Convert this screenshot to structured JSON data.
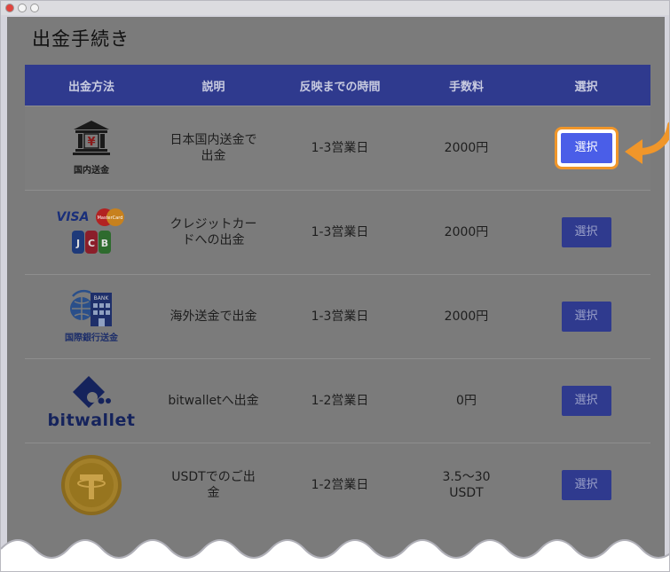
{
  "page": {
    "title": "出金手続き"
  },
  "table": {
    "headers": [
      "出金方法",
      "説明",
      "反映までの時間",
      "手数料",
      "選択"
    ],
    "rows": [
      {
        "method_label": "国内送金",
        "description": "日本国内送金で出金",
        "time": "1-3営業日",
        "fee": "2000円",
        "button": "選択",
        "icon": "bank-icon",
        "highlighted": true
      },
      {
        "method_label": "",
        "description": "クレジットカードへの出金",
        "time": "1-3営業日",
        "fee": "2000円",
        "button": "選択",
        "icon": "credit-card-logos",
        "brands": [
          "VISA",
          "MasterCard",
          "JCB"
        ]
      },
      {
        "method_label": "国際銀行送金",
        "description": "海外送金で出金",
        "time": "1-3営業日",
        "fee": "2000円",
        "button": "選択",
        "icon": "international-bank-icon",
        "bank_text": "BANK"
      },
      {
        "method_label": "bitwallet",
        "description": "bitwalletへ出金",
        "time": "1-2営業日",
        "fee": "0円",
        "button": "選択",
        "icon": "bitwallet-logo"
      },
      {
        "method_label": "",
        "description": "USDTでのご出金",
        "time": "1-2営業日",
        "fee": "3.5～30 USDT",
        "button": "選択",
        "icon": "usdt-coin-icon"
      }
    ]
  },
  "colors": {
    "header_bg": "#2f3a8e",
    "overlay": "#7b7b7b",
    "highlight_button": "#4a5ee8",
    "callout_orange": "#f0962a"
  }
}
